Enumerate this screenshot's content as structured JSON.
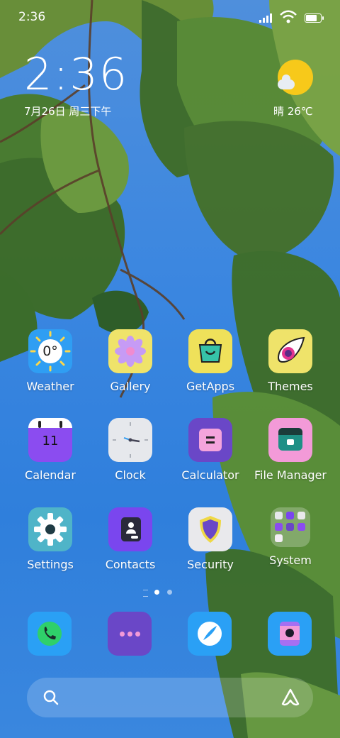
{
  "status_bar": {
    "time": "2:36"
  },
  "clock_widget": {
    "time": "2:36",
    "date": "7月26日 周三下午"
  },
  "weather_widget": {
    "text": "晴 26℃",
    "icon": "sun-cloud-icon"
  },
  "apps": [
    {
      "id": "weather",
      "label": "Weather",
      "icon": "weather-icon",
      "temp": "0°"
    },
    {
      "id": "gallery",
      "label": "Gallery",
      "icon": "flower-icon"
    },
    {
      "id": "getapps",
      "label": "GetApps",
      "icon": "shopping-bag-icon"
    },
    {
      "id": "themes",
      "label": "Themes",
      "icon": "brush-icon"
    },
    {
      "id": "calendar",
      "label": "Calendar",
      "icon": "calendar-icon",
      "day": "11"
    },
    {
      "id": "clock",
      "label": "Clock",
      "icon": "clock-icon"
    },
    {
      "id": "calculator",
      "label": "Calculator",
      "icon": "calculator-icon"
    },
    {
      "id": "file-manager",
      "label": "File Manager",
      "icon": "folder-icon"
    },
    {
      "id": "settings",
      "label": "Settings",
      "icon": "gear-icon"
    },
    {
      "id": "contacts",
      "label": "Contacts",
      "icon": "contacts-book-icon"
    },
    {
      "id": "security",
      "label": "Security",
      "icon": "shield-icon"
    },
    {
      "id": "system",
      "label": "System",
      "icon": "folder-grid-icon"
    }
  ],
  "page_indicator": {
    "pages": 2,
    "current": 1
  },
  "dock": [
    {
      "id": "phone",
      "icon": "phone-icon"
    },
    {
      "id": "messages",
      "icon": "message-dots-icon"
    },
    {
      "id": "browser",
      "icon": "browser-icon"
    },
    {
      "id": "camera",
      "icon": "camera-icon"
    }
  ],
  "search_bar": {
    "left_icon": "search-icon",
    "right_icon": "assistant-icon"
  },
  "colors": {
    "weather_bg": "#2f9ef3",
    "gallery_bg": "#efe36a",
    "getapps_bg": "#efe15a",
    "themes_bg": "#efe36a",
    "calendar_bg": "#8b4cf0",
    "clock_bg": "#e6e8ec",
    "calculator_bg": "#6a47c7",
    "filemanager_bg": "#f39ad8",
    "settings_bg": "#4fb4c8",
    "contacts_bg": "#7a46ee",
    "security_bg": "#e9e9ec",
    "dock_blue": "#2aa0f5",
    "dock_purple": "#6a47c7"
  }
}
